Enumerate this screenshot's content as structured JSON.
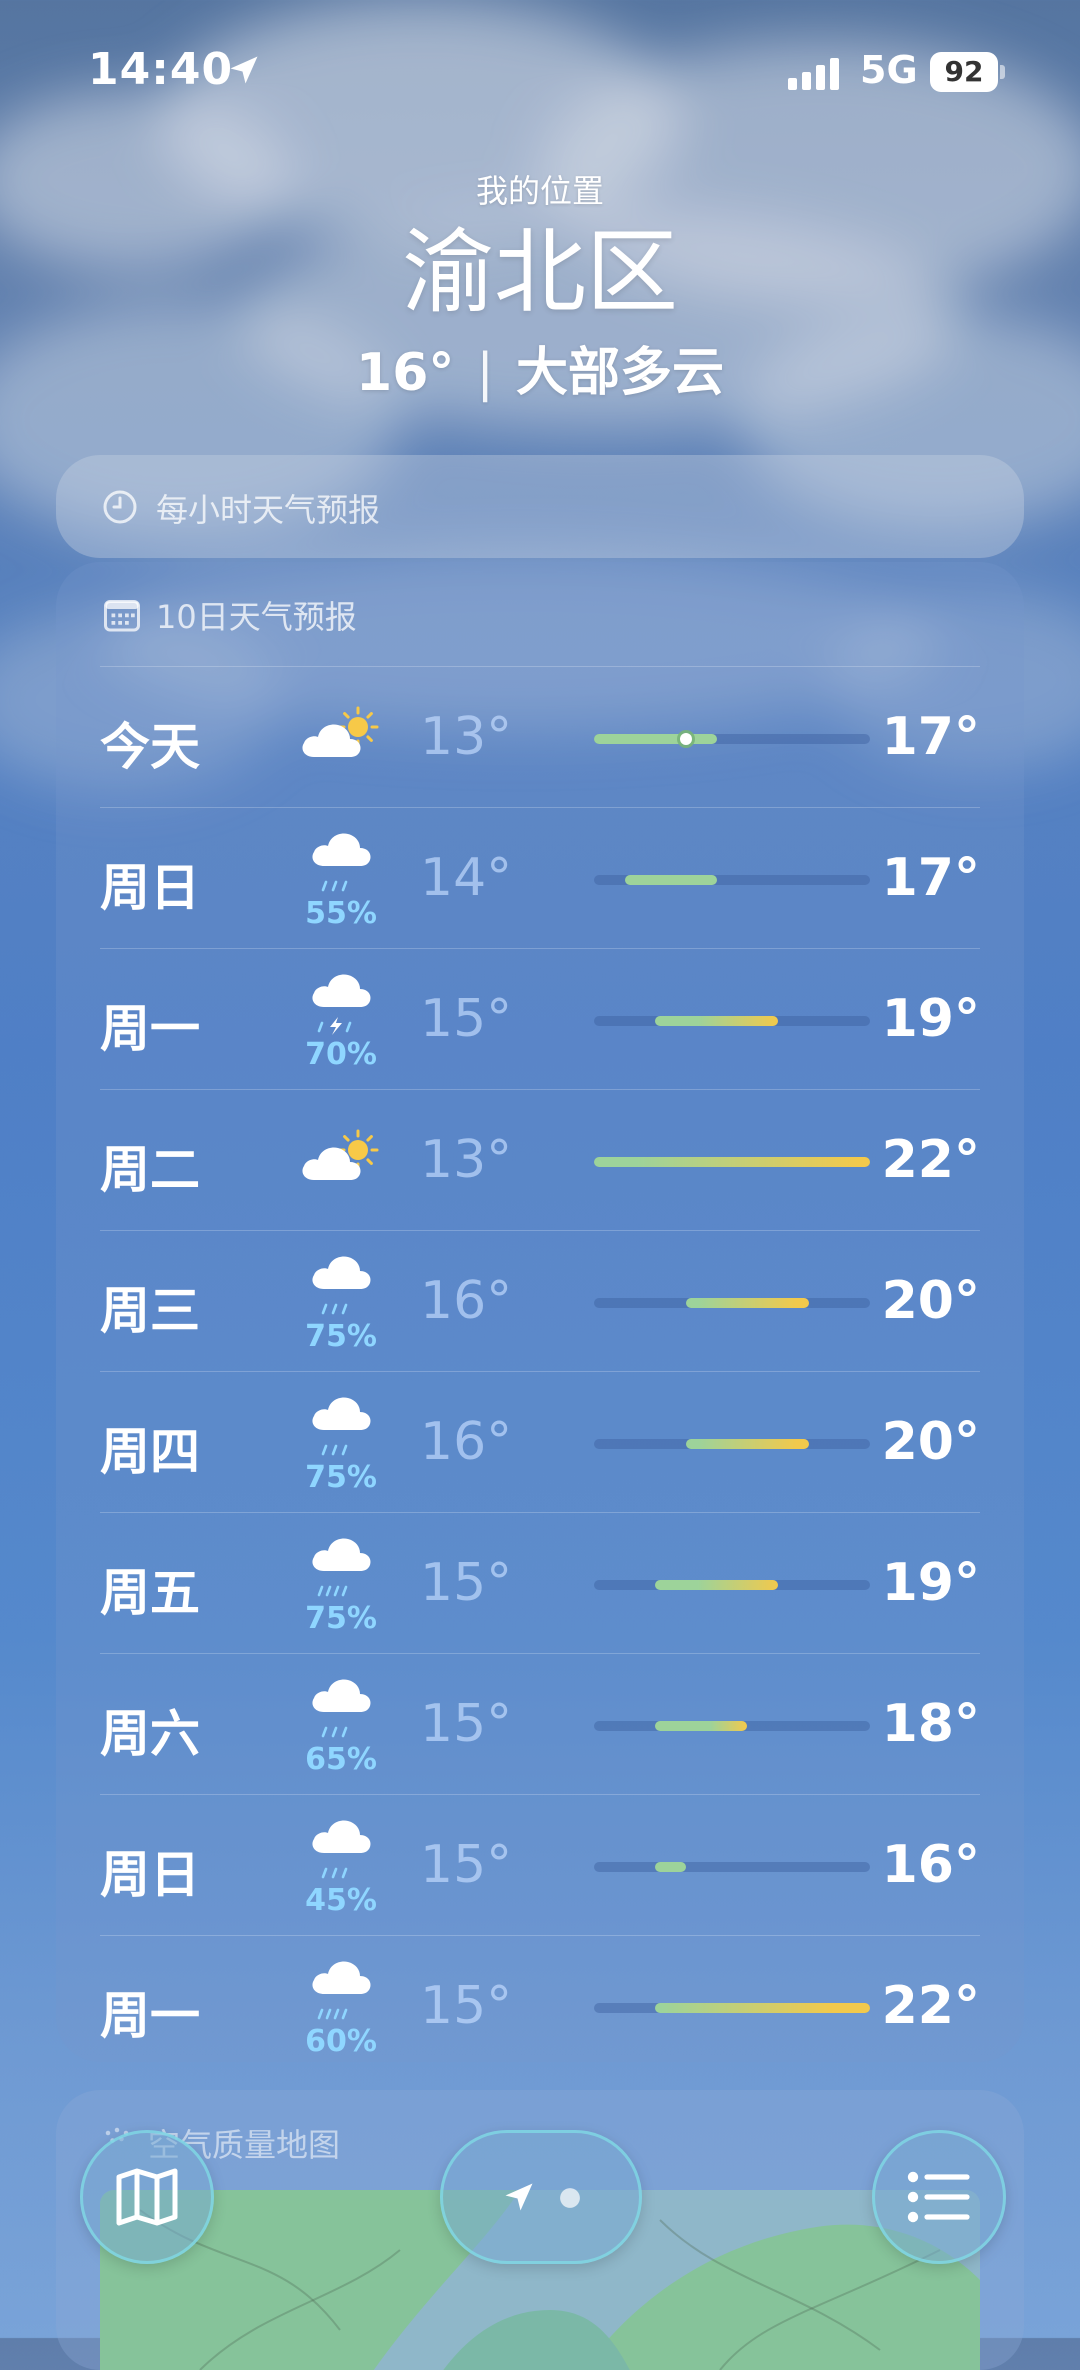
{
  "status_bar": {
    "time": "14:40",
    "network": "5G",
    "battery": "92"
  },
  "header": {
    "location_label": "我的位置",
    "city": "渝北区",
    "temperature": "16°",
    "condition": "大部多云"
  },
  "hourly_card": {
    "title": "每小时天气预报",
    "icon": "clock-icon"
  },
  "daily_card": {
    "title": "10日天气预报",
    "icon": "calendar-icon",
    "range_min": 13,
    "range_max": 22,
    "days": [
      {
        "day": "今天",
        "icon": "partly-sunny-icon",
        "precip": "",
        "low": "13°",
        "high": "17°",
        "low_val": 13,
        "high_val": 17,
        "current": 16
      },
      {
        "day": "周日",
        "icon": "rain-cloud-icon",
        "precip": "55%",
        "low": "14°",
        "high": "17°",
        "low_val": 14,
        "high_val": 17
      },
      {
        "day": "周一",
        "icon": "thunderstorm-icon",
        "precip": "70%",
        "low": "15°",
        "high": "19°",
        "low_val": 15,
        "high_val": 19
      },
      {
        "day": "周二",
        "icon": "partly-sunny-icon",
        "precip": "",
        "low": "13°",
        "high": "22°",
        "low_val": 13,
        "high_val": 22
      },
      {
        "day": "周三",
        "icon": "rain-cloud-icon",
        "precip": "75%",
        "low": "16°",
        "high": "20°",
        "low_val": 16,
        "high_val": 20
      },
      {
        "day": "周四",
        "icon": "rain-cloud-icon",
        "precip": "75%",
        "low": "16°",
        "high": "20°",
        "low_val": 16,
        "high_val": 20
      },
      {
        "day": "周五",
        "icon": "heavy-rain-icon",
        "precip": "75%",
        "low": "15°",
        "high": "19°",
        "low_val": 15,
        "high_val": 19
      },
      {
        "day": "周六",
        "icon": "rain-cloud-icon",
        "precip": "65%",
        "low": "15°",
        "high": "18°",
        "low_val": 15,
        "high_val": 18
      },
      {
        "day": "周日",
        "icon": "rain-cloud-icon",
        "precip": "45%",
        "low": "15°",
        "high": "16°",
        "low_val": 15,
        "high_val": 16
      },
      {
        "day": "周一",
        "icon": "heavy-rain-icon",
        "precip": "60%",
        "low": "15°",
        "high": "22°",
        "low_val": 15,
        "high_val": 22
      }
    ]
  },
  "air_quality_card": {
    "title": "空气质量地图"
  },
  "toolbar": {
    "map_button": "map-icon",
    "location_button": "location-page-icon",
    "list_button": "list-icon"
  },
  "colors": {
    "precip": "#8fd6ff",
    "bar_cool": "#9dd39a",
    "bar_warm": "#f2c94c"
  }
}
